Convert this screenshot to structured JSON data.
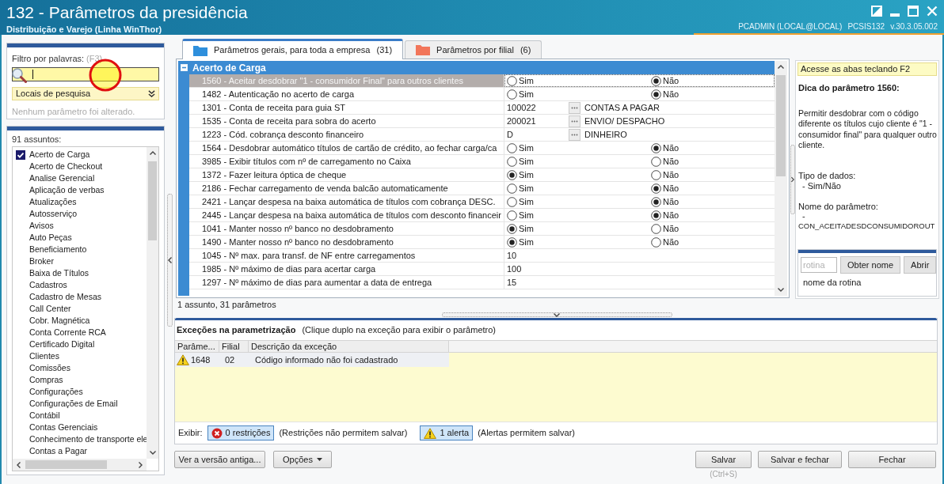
{
  "window": {
    "title": "132 - Parâmetros da presidência",
    "subtitle": "Distribuição e Varejo (Linha WinThor)",
    "user": "PCADMIN (LOCAL@LOCAL)",
    "program": "PCSIS132",
    "version": "v.30.3.05.002"
  },
  "filter": {
    "label": "Filtro por palavras:",
    "shortcut": "(F3)",
    "search_locations": "Locais de pesquisa",
    "status": "Nenhum parâmetro foi alterado."
  },
  "subjects": {
    "count_label": "91 assuntos:",
    "items": [
      {
        "label": "Acerto de Carga",
        "checked": true
      },
      {
        "label": "Acerto de Checkout",
        "checked": false
      },
      {
        "label": "Analise Gerencial",
        "checked": false
      },
      {
        "label": "Aplicação de verbas",
        "checked": false
      },
      {
        "label": "Atualizações",
        "checked": false
      },
      {
        "label": "Autosserviço",
        "checked": false
      },
      {
        "label": "Avisos",
        "checked": false
      },
      {
        "label": "Auto Peças",
        "checked": false
      },
      {
        "label": "Beneficiamento",
        "checked": false
      },
      {
        "label": "Broker",
        "checked": false
      },
      {
        "label": "Baixa de Títulos",
        "checked": false
      },
      {
        "label": "Cadastros",
        "checked": false
      },
      {
        "label": "Cadastro de Mesas",
        "checked": false
      },
      {
        "label": "Call Center",
        "checked": false
      },
      {
        "label": "Cobr. Magnética",
        "checked": false
      },
      {
        "label": "Conta Corrente RCA",
        "checked": false
      },
      {
        "label": "Certificado Digital",
        "checked": false
      },
      {
        "label": "Clientes",
        "checked": false
      },
      {
        "label": "Comissões",
        "checked": false
      },
      {
        "label": "Compras",
        "checked": false
      },
      {
        "label": "Configurações",
        "checked": false
      },
      {
        "label": "Configurações de Email",
        "checked": false
      },
      {
        "label": "Contábil",
        "checked": false
      },
      {
        "label": "Contas Gerenciais",
        "checked": false
      },
      {
        "label": "Conhecimento de transporte ele",
        "checked": false
      },
      {
        "label": "Contas a Pagar",
        "checked": false
      }
    ]
  },
  "tabs": [
    {
      "label": "Parâmetros gerais, para toda a empresa",
      "count": "(31)",
      "selected": true,
      "color": "#2e8fdc"
    },
    {
      "label": "Parâmetros por filial",
      "count": "(6)",
      "selected": false,
      "color": "#f2765a"
    }
  ],
  "grid": {
    "group": {
      "label": "Acerto de Carga",
      "expanded": true
    },
    "rows": [
      {
        "kind": "boolean",
        "name": "1560 - Aceitar desdobrar \"1 - consumidor Final\" para outros clientes",
        "selected": true,
        "options": [
          {
            "label": "Sim",
            "selected": false
          },
          {
            "label": "Não",
            "selected": true
          }
        ]
      },
      {
        "kind": "boolean",
        "name": "1482 - Autenticação no acerto de carga",
        "selected": false,
        "options": [
          {
            "label": "Sim",
            "selected": false
          },
          {
            "label": "Não",
            "selected": true
          }
        ]
      },
      {
        "kind": "lookup",
        "name": "1301 - Conta de receita para guia ST",
        "selected": false,
        "value": "100022",
        "description": "CONTAS A PAGAR"
      },
      {
        "kind": "lookup",
        "name": "1535 - Conta de receita para sobra do acerto",
        "selected": false,
        "value": "200021",
        "description": "ENVIO/ DESPACHO"
      },
      {
        "kind": "lookup",
        "name": "1223 - Cód. cobrança desconto financeiro",
        "selected": false,
        "value": "D",
        "description": "DINHEIRO"
      },
      {
        "kind": "boolean",
        "name": "1564 - Desdobrar automático títulos de cartão de crédito, ao fechar carga/ca",
        "selected": false,
        "options": [
          {
            "label": "Sim",
            "selected": false
          },
          {
            "label": "Não",
            "selected": true
          }
        ]
      },
      {
        "kind": "boolean",
        "name": "3985 - Exibir títulos com nº de carregamento no Caixa",
        "selected": false,
        "options": [
          {
            "label": "Sim",
            "selected": false
          },
          {
            "label": "Não",
            "selected": false
          }
        ]
      },
      {
        "kind": "boolean",
        "name": "1372 - Fazer leitura óptica de cheque",
        "selected": false,
        "options": [
          {
            "label": "Sim",
            "selected": true
          },
          {
            "label": "Não",
            "selected": false
          }
        ]
      },
      {
        "kind": "boolean",
        "name": "2186 - Fechar carregamento de venda balcão automaticamente",
        "selected": false,
        "options": [
          {
            "label": "Sim",
            "selected": false
          },
          {
            "label": "Não",
            "selected": true
          }
        ]
      },
      {
        "kind": "boolean",
        "name": "2421 - Lançar despesa na baixa automática de títulos com cobrança DESC.",
        "selected": false,
        "options": [
          {
            "label": "Sim",
            "selected": false
          },
          {
            "label": "Não",
            "selected": true
          }
        ]
      },
      {
        "kind": "boolean",
        "name": "2445 - Lançar despesa na baixa automática de títulos com desconto financeir",
        "selected": false,
        "options": [
          {
            "label": "Sim",
            "selected": false
          },
          {
            "label": "Não",
            "selected": true
          }
        ]
      },
      {
        "kind": "boolean",
        "name": "1041 - Manter nosso nº banco no desdobramento",
        "selected": false,
        "options": [
          {
            "label": "Sim",
            "selected": true
          },
          {
            "label": "Não",
            "selected": false
          }
        ]
      },
      {
        "kind": "boolean",
        "name": "1490 - Manter nosso nº banco no desdobramento",
        "selected": false,
        "options": [
          {
            "label": "Sim",
            "selected": true
          },
          {
            "label": "Não",
            "selected": false
          }
        ]
      },
      {
        "kind": "text",
        "name": "1045 - Nº max. para transf. de NF entre carregamentos",
        "selected": false,
        "value": "10"
      },
      {
        "kind": "text",
        "name": "1985 - Nº máximo de dias para acertar carga",
        "selected": false,
        "value": "100"
      },
      {
        "kind": "text",
        "name": "1297 - Nº máximo de dias para aumentar a data de entrega",
        "selected": false,
        "value": "15"
      }
    ],
    "summary": "1 assunto, 31 parâmetros"
  },
  "tip_panel": {
    "hint": "Acesse as abas teclando F2",
    "title": "Dica do parâmetro 1560:",
    "description": "Permitir desdobrar com o código diferente os títulos cujo cliente é \"1 - consumidor final\" para qualquer outro cliente.",
    "data_type_label": "Tipo de dados:",
    "data_type": "- Sim/Não",
    "name_label": "Nome do parâmetro:",
    "name_dash": "-",
    "name": "CON_ACEITADESDCONSUMIDOROUT"
  },
  "routine_lookup": {
    "placeholder": "rotina",
    "buttons": [
      "Obter nome",
      "Abrir"
    ],
    "result": "nome da rotina"
  },
  "exceptions": {
    "title": "Exceções na parametrização",
    "hint": "(Clique duplo na exceção para exibir o parâmetro)",
    "columns": [
      "Parâme...",
      "Filial",
      "Descrição da exceção"
    ],
    "rows": [
      {
        "kind": "alert",
        "cells": [
          "1648",
          "02",
          "Código informado não foi cadastrado"
        ]
      }
    ],
    "filter_label": "Exibir:",
    "filters": [
      {
        "kind": "restriction",
        "label": "0 restrições",
        "note": "(Restrições não permitem salvar)",
        "pressed": true
      },
      {
        "kind": "alert",
        "label": "1 alerta",
        "note": "(Alertas permitem salvar)",
        "pressed": true
      }
    ]
  },
  "footer": {
    "left_buttons": [
      {
        "label": "Ver a versão antiga...",
        "dropdown": false
      },
      {
        "label": "Opções",
        "dropdown": true
      }
    ],
    "right_buttons": [
      {
        "label": "Salvar",
        "shortcut": "(Ctrl+S)"
      },
      {
        "label": "Salvar e fechar"
      },
      {
        "label": "Fechar"
      }
    ]
  }
}
